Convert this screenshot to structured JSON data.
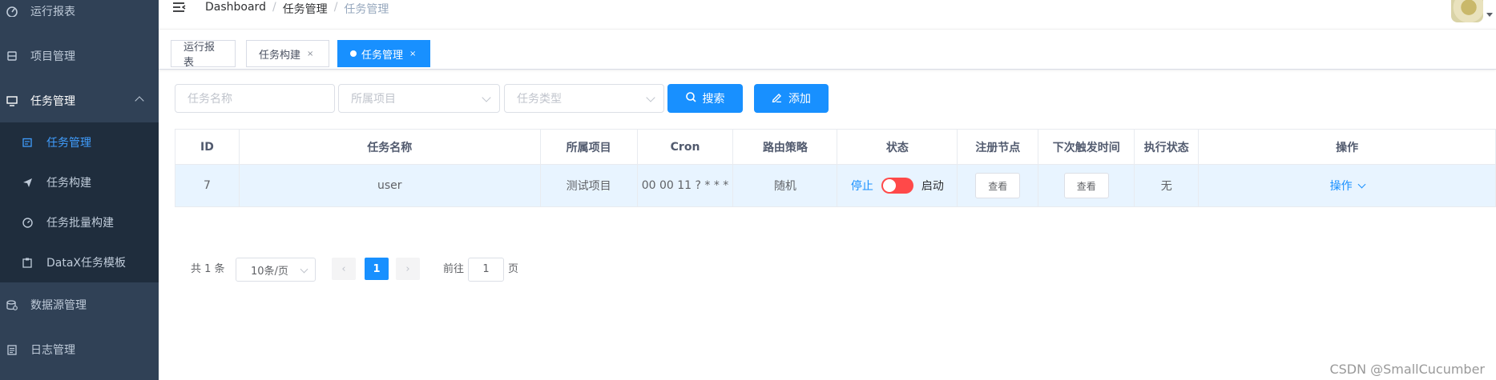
{
  "sidebar": {
    "items": [
      {
        "label": "运行报表",
        "icon": "dashboard-icon"
      },
      {
        "label": "项目管理",
        "icon": "database-icon"
      },
      {
        "label": "任务管理",
        "icon": "monitor-icon"
      }
    ],
    "submenu": [
      {
        "label": "任务管理",
        "icon": "calendar-icon",
        "active": true
      },
      {
        "label": "任务构建",
        "icon": "send-icon"
      },
      {
        "label": "任务批量构建",
        "icon": "gauge-icon"
      },
      {
        "label": "DataX任务模板",
        "icon": "clipboard-icon"
      }
    ],
    "bottom_items": [
      {
        "label": "数据源管理",
        "icon": "storage-icon"
      },
      {
        "label": "日志管理",
        "icon": "document-icon"
      }
    ]
  },
  "navbar": {
    "breadcrumb": [
      "Dashboard",
      "任务管理",
      "任务管理"
    ],
    "separator": "/"
  },
  "tags": [
    {
      "label": "运行报表"
    },
    {
      "label": "任务构建",
      "close": "×"
    },
    {
      "label": "任务管理",
      "close": "×",
      "active": true
    }
  ],
  "filters": {
    "task_name_placeholder": "任务名称",
    "project_placeholder": "所属项目",
    "task_type_placeholder": "任务类型",
    "search_label": "搜索",
    "add_label": "添加"
  },
  "table": {
    "headers": [
      "ID",
      "任务名称",
      "所属项目",
      "Cron",
      "路由策略",
      "状态",
      "注册节点",
      "下次触发时间",
      "执行状态",
      "操作"
    ],
    "rows": [
      {
        "id": "7",
        "name": "user",
        "project": "测试项目",
        "cron": "00 00 11 ? * * *",
        "route": "随机",
        "status_off": "停止",
        "status_on": "启动",
        "status_value": false,
        "nodes_btn": "查看",
        "next_trigger_btn": "查看",
        "exec_status": "无",
        "action": "操作"
      }
    ]
  },
  "pagination": {
    "total": "共 1 条",
    "page_size": "10条/页",
    "prev": "‹",
    "current": "1",
    "next": "›",
    "goto_label": "前往",
    "goto_value": "1",
    "page_suffix": "页"
  },
  "watermark": "CSDN @SmallCucumber",
  "colors": {
    "sidebar_bg": "#304156",
    "submenu_bg": "#1f2d3d",
    "primary": "#1890ff",
    "switch_off": "#ff4949",
    "row_hover": "#e8f4ff"
  }
}
